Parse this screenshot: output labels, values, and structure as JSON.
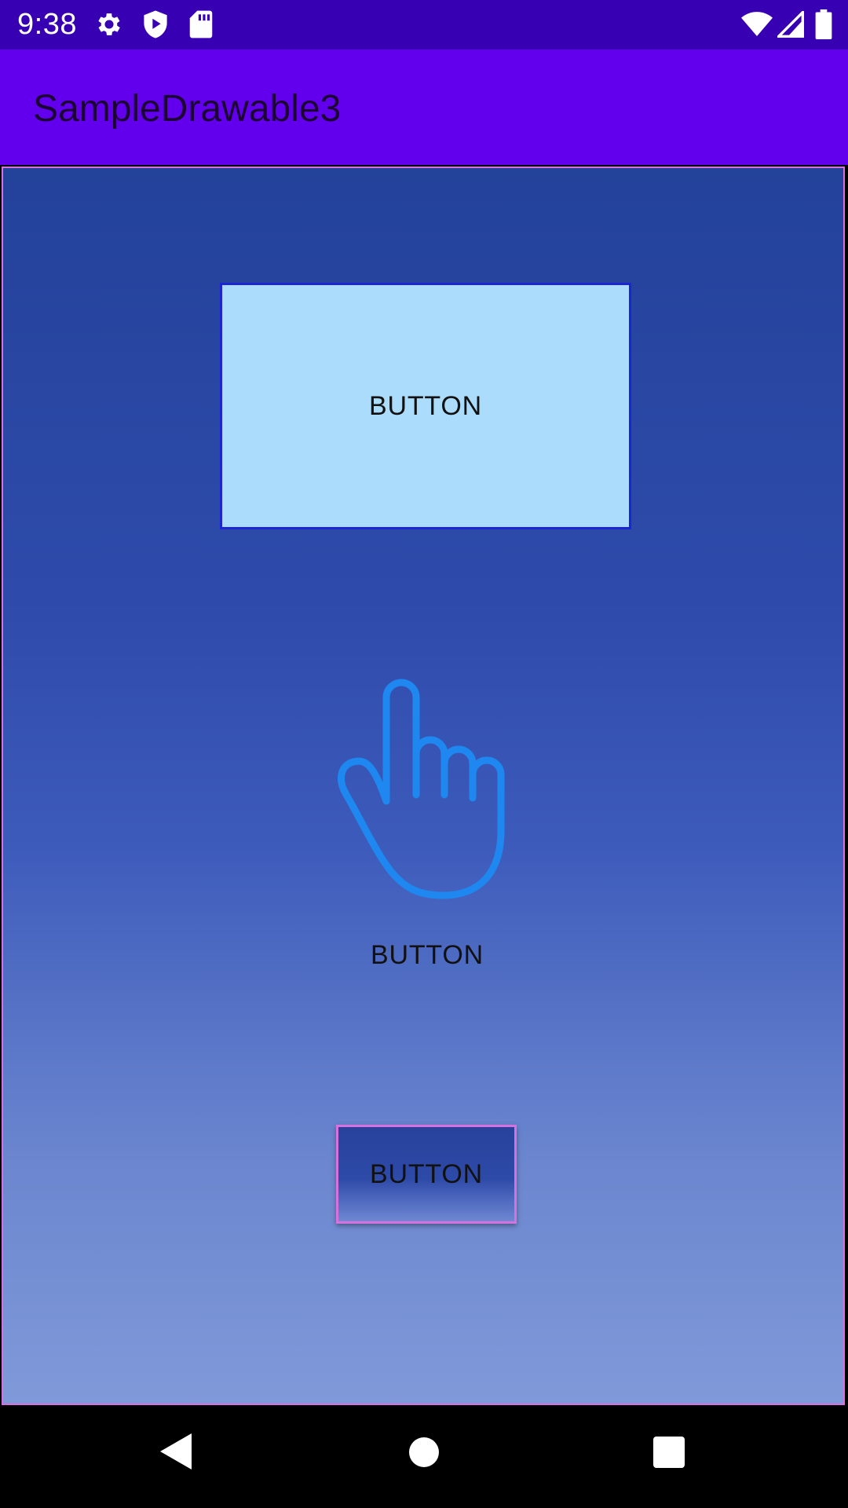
{
  "status_bar": {
    "time": "9:38",
    "icons_left": [
      "gear-icon",
      "play-protect-icon",
      "sd-card-icon"
    ],
    "icons_right": [
      "wifi-icon",
      "signal-icon",
      "battery-icon"
    ]
  },
  "app_bar": {
    "title": "SampleDrawable3"
  },
  "buttons": {
    "rect_button": "BUTTON",
    "hand_button": "BUTTON",
    "gradient_button": "BUTTON"
  },
  "nav_bar": {
    "buttons": [
      "back-icon",
      "home-icon",
      "recents-icon"
    ]
  },
  "colors": {
    "status_bar": "#3700B3",
    "app_bar": "#6200EE",
    "content_border": "#d870e0",
    "rect_button_fill": "#abdcfb",
    "rect_button_border": "#1b25d4",
    "hand_icon": "#1e88f0"
  }
}
